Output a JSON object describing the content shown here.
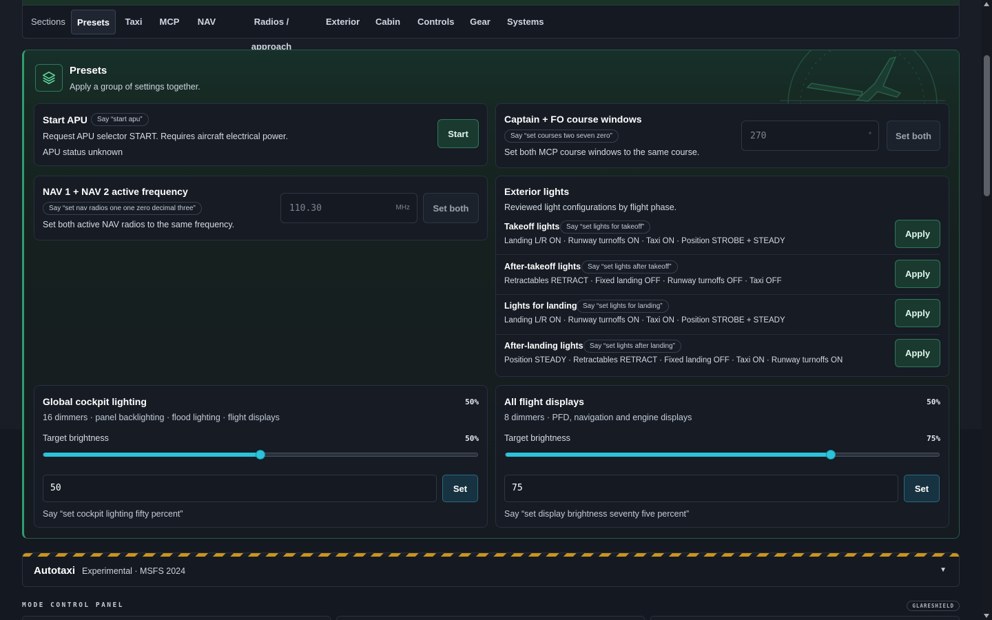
{
  "tabs": [
    "Sections",
    "Presets",
    "Taxi",
    "MCP",
    "NAV",
    "Radios / approach",
    "Exterior",
    "Cabin",
    "Controls",
    "Gear",
    "Systems"
  ],
  "presets": {
    "title": "Presets",
    "subtitle": "Apply a group of settings together."
  },
  "apu": {
    "title": "Start APU",
    "say": "Say “start apu”",
    "desc": "Request APU selector START. Requires aircraft electrical power.",
    "status": "APU status unknown",
    "button": "Start"
  },
  "course": {
    "title": "Captain + FO course windows",
    "say": "Say “set courses two seven zero”",
    "desc": "Set both MCP course windows to the same course.",
    "placeholder": "270",
    "unit": "°",
    "button": "Set both"
  },
  "nav": {
    "title": "NAV 1 + NAV 2 active frequency",
    "say": "Say “set nav radios one one zero decimal three”",
    "desc": "Set both active NAV radios to the same frequency.",
    "placeholder": "110.30",
    "unit": "MHz",
    "button": "Set both"
  },
  "exterior": {
    "title": "Exterior lights",
    "subtitle": "Reviewed light configurations by flight phase.",
    "rows": [
      {
        "name": "Takeoff lights",
        "say": "Say “set lights for takeoff”",
        "desc": "Landing L/R ON · Runway turnoffs ON · Taxi ON · Position STROBE + STEADY",
        "button": "Apply"
      },
      {
        "name": "After-takeoff lights",
        "say": "Say “set lights after takeoff”",
        "desc": "Retractables RETRACT · Fixed landing OFF · Runway turnoffs OFF · Taxi OFF",
        "button": "Apply"
      },
      {
        "name": "Lights for landing",
        "say": "Say “set lights for landing”",
        "desc": "Landing L/R ON · Runway turnoffs ON · Taxi ON · Position STROBE + STEADY",
        "button": "Apply"
      },
      {
        "name": "After-landing lights",
        "say": "Say “set lights after landing”",
        "desc": "Position STEADY · Retractables RETRACT · Fixed landing OFF · Taxi ON · Runway turnoffs ON",
        "button": "Apply"
      }
    ]
  },
  "cockpit": {
    "title": "Global cockpit lighting",
    "level": "50%",
    "desc": "16 dimmers · panel backlighting · flood lighting · flight displays",
    "target_label": "Target brightness",
    "target_pct": "50%",
    "slider_value": 0.5,
    "input_value": "50",
    "button": "Set",
    "say": "Say “set cockpit lighting fifty percent”"
  },
  "displays": {
    "title": "All flight displays",
    "level": "50%",
    "desc": "8 dimmers · PFD, navigation and engine displays",
    "target_label": "Target brightness",
    "target_pct": "75%",
    "slider_value": 0.75,
    "input_value": "75",
    "button": "Set",
    "say": "Say “set display brightness seventy five percent”"
  },
  "autotaxi": {
    "title": "Autotaxi",
    "subtitle": "Experimental · MSFS 2024",
    "chevron": "▼"
  },
  "mcp_section": {
    "label": "MODE CONTROL PANEL",
    "chip": "GLARESHIELD"
  },
  "colors": {
    "accent_green": "#2f9e6c",
    "slider_cyan": "#2bc3db",
    "hazard_amber": "#c9931e"
  }
}
